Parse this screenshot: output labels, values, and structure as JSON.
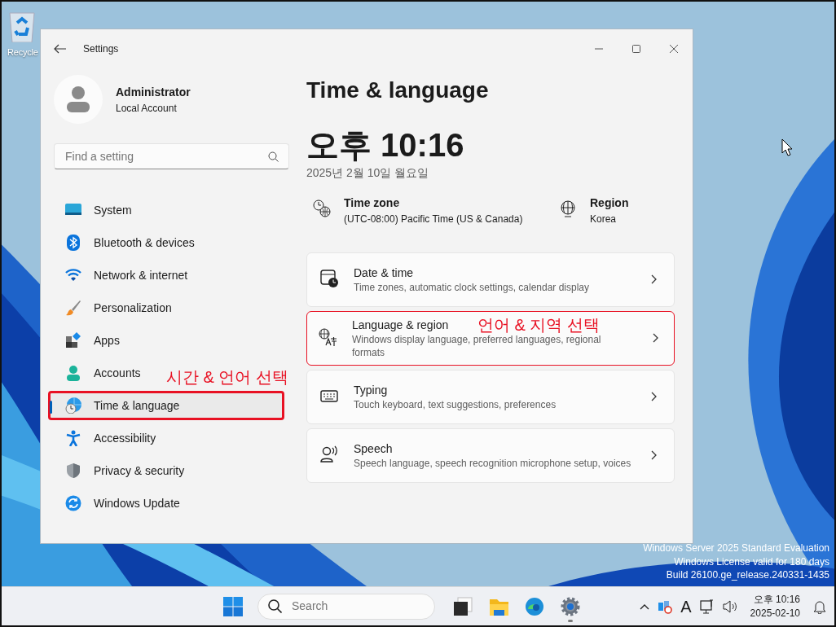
{
  "desktop": {
    "icons": [
      {
        "label": "Recycle"
      }
    ],
    "notice": [
      "Windows Server 2025 Standard Evaluation",
      "Windows License valid for 180 days",
      "Build 26100.ge_release.240331-1435"
    ]
  },
  "window": {
    "title": "Settings"
  },
  "account": {
    "name": "Administrator",
    "type": "Local Account"
  },
  "search": {
    "placeholder": "Find a setting"
  },
  "nav": [
    {
      "kind": "system",
      "label": "System",
      "selected": false,
      "highlighted": false
    },
    {
      "kind": "bluetooth",
      "label": "Bluetooth & devices",
      "selected": false,
      "highlighted": false
    },
    {
      "kind": "network",
      "label": "Network & internet",
      "selected": false,
      "highlighted": false
    },
    {
      "kind": "personalization",
      "label": "Personalization",
      "selected": false,
      "highlighted": false
    },
    {
      "kind": "apps",
      "label": "Apps",
      "selected": false,
      "highlighted": false
    },
    {
      "kind": "accounts",
      "label": "Accounts",
      "selected": false,
      "highlighted": false
    },
    {
      "kind": "time",
      "label": "Time & language",
      "selected": true,
      "highlighted": true,
      "callout": "시간 & 언어 선택"
    },
    {
      "kind": "accessibility",
      "label": "Accessibility",
      "selected": false,
      "highlighted": false
    },
    {
      "kind": "privacy",
      "label": "Privacy & security",
      "selected": false,
      "highlighted": false
    },
    {
      "kind": "update",
      "label": "Windows Update",
      "selected": false,
      "highlighted": false
    }
  ],
  "page": {
    "title": "Time & language",
    "time": "오후 10:16",
    "date": "2025년 2월 10일 월요일",
    "summary": [
      {
        "kind": "timezone",
        "label": "Time zone",
        "value": "(UTC-08:00) Pacific Time (US & Canada)"
      },
      {
        "kind": "region",
        "label": "Region",
        "value": "Korea"
      }
    ],
    "cards": [
      {
        "kind": "datetime",
        "title": "Date & time",
        "description": "Time zones, automatic clock settings, calendar display",
        "highlighted": false
      },
      {
        "kind": "language",
        "title": "Language & region",
        "description": "Windows display language, preferred languages, regional formats",
        "highlighted": true,
        "callout": "언어 & 지역 선택"
      },
      {
        "kind": "typing",
        "title": "Typing",
        "description": "Touch keyboard, text suggestions, preferences",
        "highlighted": false
      },
      {
        "kind": "speech",
        "title": "Speech",
        "description": "Speech language, speech recognition microphone setup, voices",
        "highlighted": false
      }
    ]
  },
  "taskbar": {
    "search_placeholder": "Search",
    "apps": [
      {
        "kind": "taskview",
        "running": false
      },
      {
        "kind": "explorer",
        "running": false
      },
      {
        "kind": "browser",
        "running": false
      },
      {
        "kind": "settings",
        "running": true
      }
    ],
    "input_indicator": "A",
    "time": "오후 10:16",
    "date": "2025-02-10"
  }
}
